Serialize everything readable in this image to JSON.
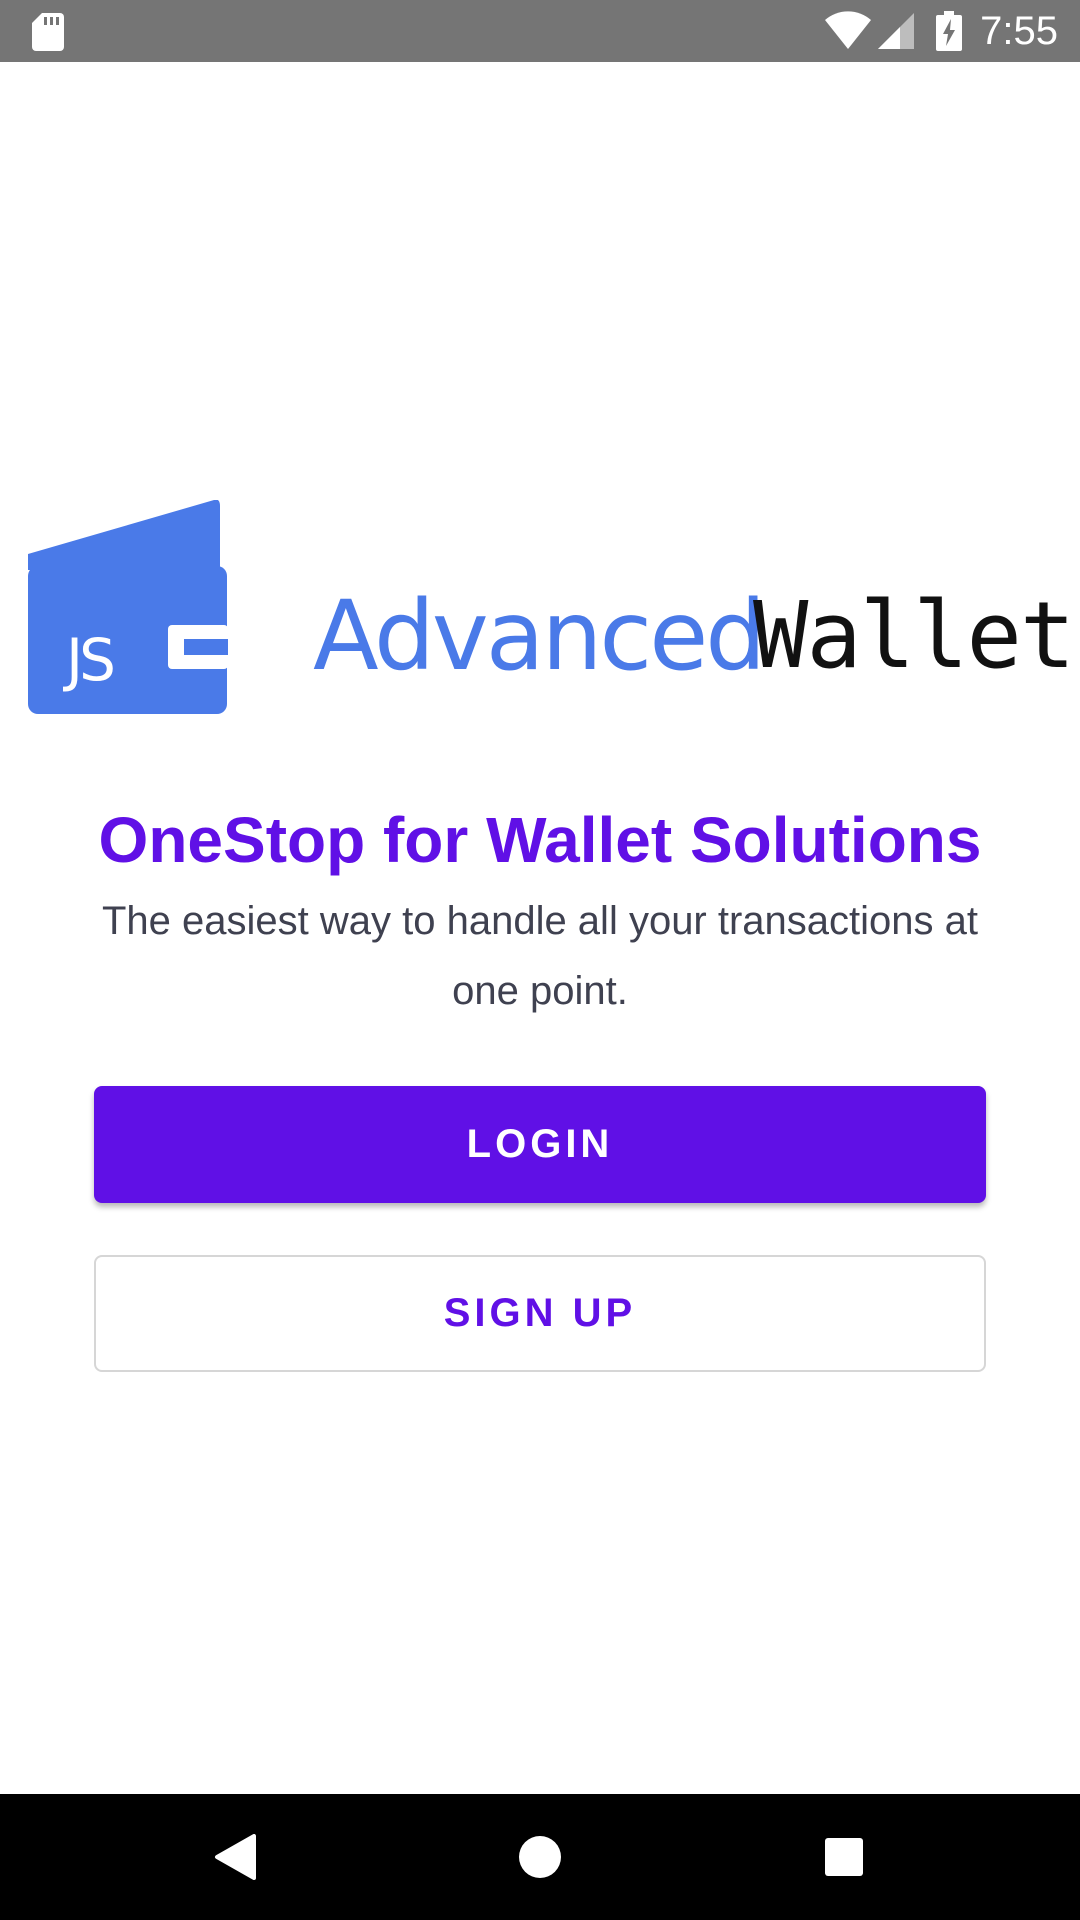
{
  "status_bar": {
    "time": "7:55",
    "icons": [
      "sd-card-icon",
      "wifi-icon",
      "signal-icon",
      "battery-charging-icon"
    ]
  },
  "logo": {
    "icon_text": "JS",
    "brand_first": "Advanced",
    "brand_second": "Wallet"
  },
  "main": {
    "headline": "OneStop for Wallet Solutions",
    "subtitle": "The easiest way to handle all your transactions at one point."
  },
  "buttons": {
    "login_label": "LOGIN",
    "signup_label": "SIGN UP"
  },
  "nav_bar": {
    "icons": [
      "back-icon",
      "home-icon",
      "recents-icon"
    ]
  },
  "colors": {
    "primary": "#6010e6",
    "logo_blue": "#4a7ae8",
    "status_bar": "#757575",
    "subtitle_text": "#3f4150"
  }
}
